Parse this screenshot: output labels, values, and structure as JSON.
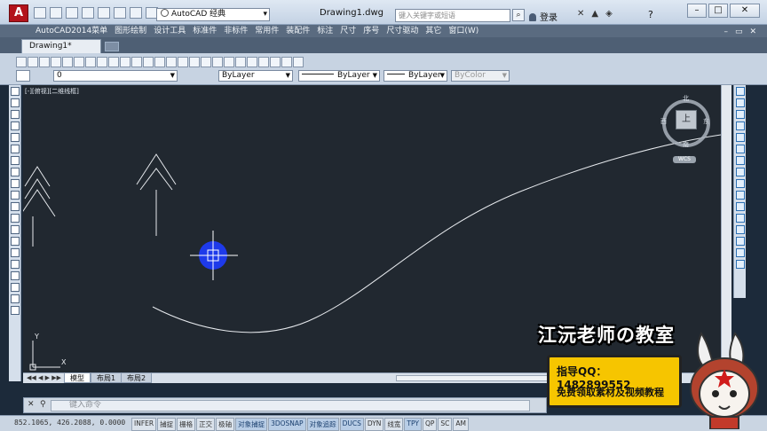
{
  "window": {
    "app_logo": "A",
    "workspace": "AutoCAD 经典",
    "doc_title": "Drawing1.dwg",
    "search_placeholder": "键入关键字或短语",
    "login_label": "登录"
  },
  "menu": {
    "items": [
      "AutoCAD2014菜单",
      "图形绘制",
      "设计工具",
      "标准件",
      "非标件",
      "常用件",
      "装配件",
      "标注",
      "尺寸",
      "序号",
      "尺寸驱动",
      "其它",
      "窗口(W)"
    ]
  },
  "tabs": {
    "document": "Drawing1*"
  },
  "properties": {
    "layer": "0",
    "color": "ByLayer",
    "linetype": "ByLayer",
    "lineweight": "ByLayer",
    "plotstyle": "ByColor"
  },
  "canvas": {
    "viewport_label": "[-][俯视][二维线框]",
    "viewcube": {
      "face": "上",
      "north": "北",
      "south": "南",
      "east": "东",
      "west": "西",
      "wcs": "WCS"
    },
    "ucs": {
      "x": "X",
      "y": "Y"
    }
  },
  "layouts": {
    "tabs": [
      "模型",
      "布局1",
      "布局2"
    ],
    "active": "模型"
  },
  "command": {
    "prompt": "键入命令"
  },
  "status": {
    "coordinates": "852.1065, 426.2088, 0.0000",
    "toggles": [
      "INFER",
      "捕捉",
      "栅格",
      "正交",
      "极轴",
      "对象捕捉",
      "3DOSNAP",
      "对象追踪",
      "DUCS",
      "DYN",
      "线宽",
      "TPY",
      "QP",
      "SC",
      "AM"
    ]
  },
  "watermark": {
    "title": "江沅老师の教室",
    "line1": "指导QQ：1482899552",
    "line2": "免费领取素材及视频教程"
  },
  "colors": {
    "canvas_bg": "#212830",
    "cursor": "#1e3cff",
    "promo_bg": "#f6c500"
  }
}
